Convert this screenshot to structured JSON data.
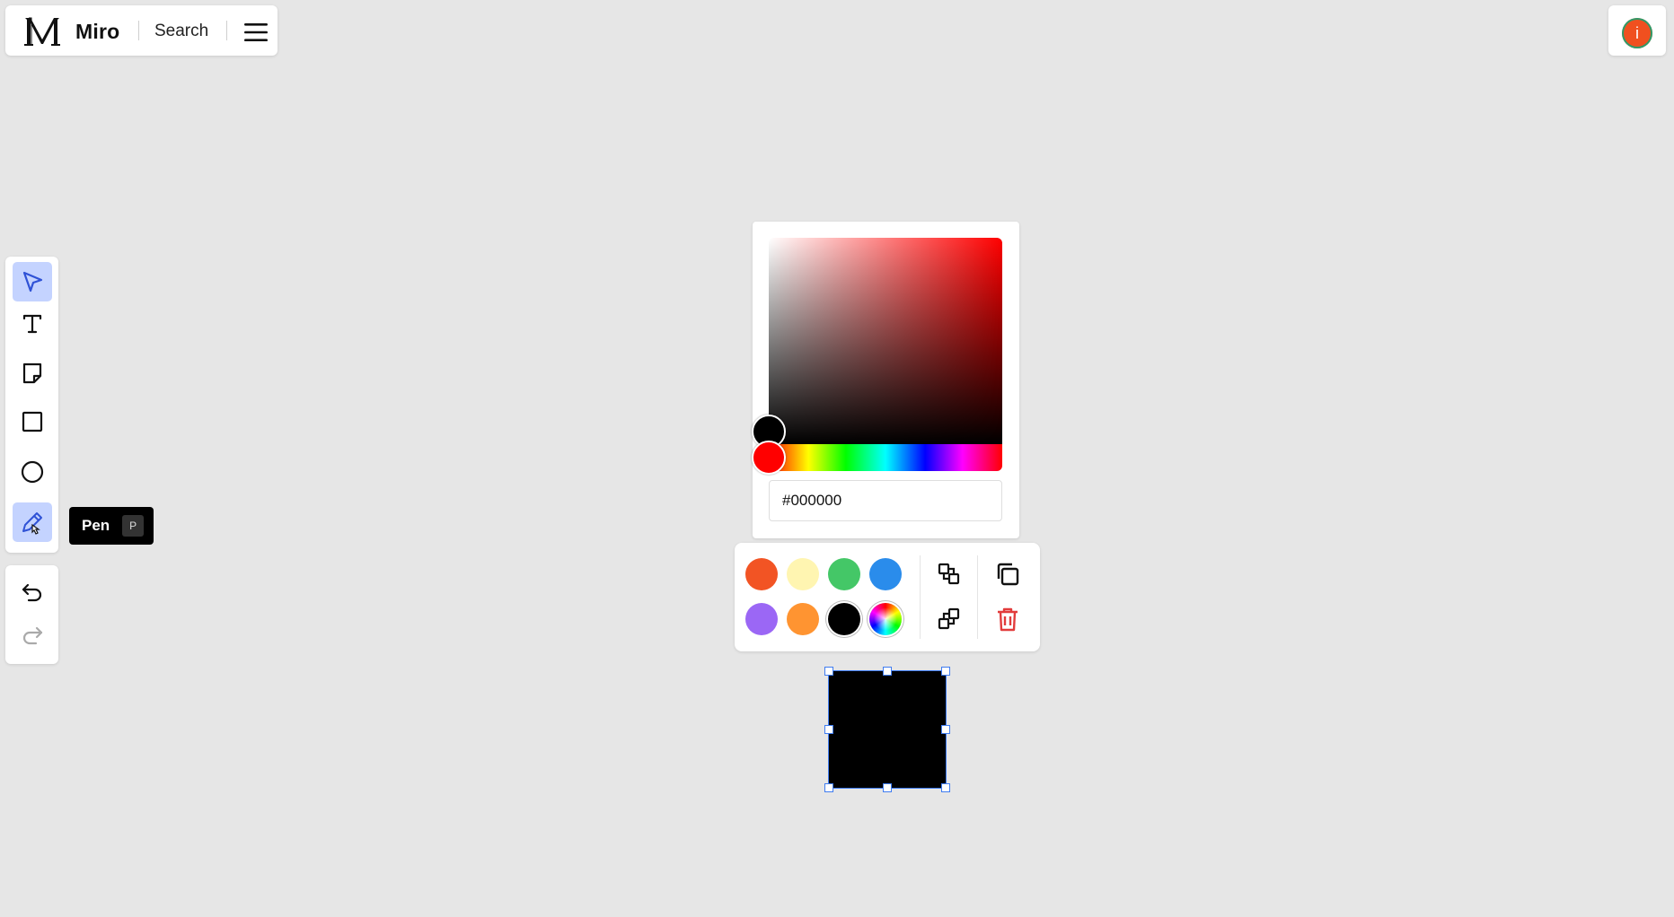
{
  "header": {
    "app_name": "Miro",
    "search_label": "Search"
  },
  "user": {
    "avatar_initial": "i",
    "avatar_color": "#f0501f"
  },
  "toolbar": {
    "tools": [
      {
        "name": "select",
        "icon": "cursor-icon",
        "active": true
      },
      {
        "name": "text",
        "icon": "text-icon",
        "active": false
      },
      {
        "name": "sticky-note",
        "icon": "sticky-note-icon",
        "active": false
      },
      {
        "name": "rectangle",
        "icon": "square-icon",
        "active": false
      },
      {
        "name": "circle",
        "icon": "circle-icon",
        "active": false
      },
      {
        "name": "pen",
        "icon": "pen-icon",
        "active": true
      }
    ],
    "history": [
      {
        "name": "undo",
        "icon": "undo-icon"
      },
      {
        "name": "redo",
        "icon": "redo-icon"
      }
    ],
    "tooltip": {
      "label": "Pen",
      "shortcut": "P"
    }
  },
  "color_picker": {
    "hex_value": "#000000",
    "selected_color": "#000000",
    "hue_color": "#ff0000"
  },
  "context_menu": {
    "swatches": [
      "#f25424",
      "#fff5b1",
      "#44c767",
      "#2a8ceb",
      "#9b67f5",
      "#ff9431",
      "#000000",
      "rainbow"
    ],
    "actions": [
      "bring-forward-icon",
      "copy-icon",
      "send-backward-icon",
      "trash-icon"
    ],
    "delete_color": "#e23c3c"
  },
  "canvas": {
    "shape_fill": "#000000",
    "selection_color": "#3f7cf0"
  }
}
